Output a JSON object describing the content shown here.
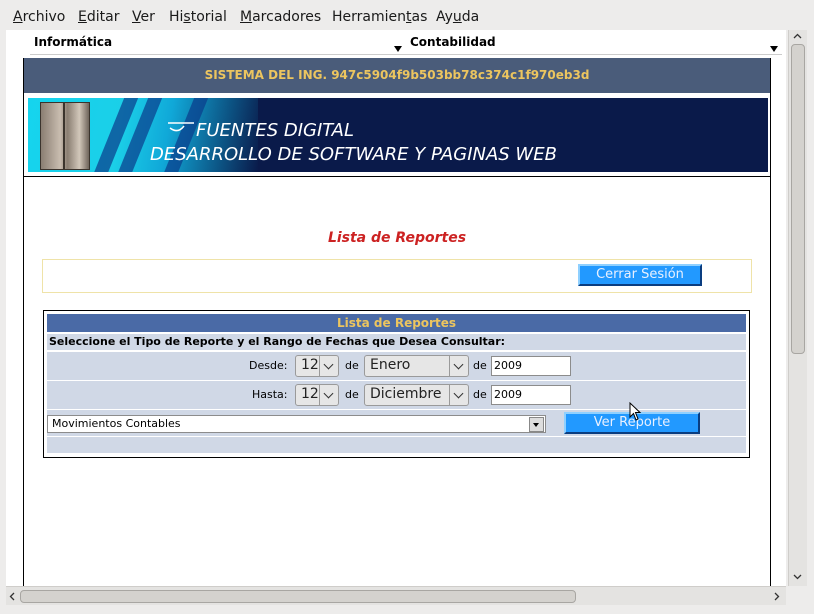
{
  "menu": [
    {
      "pre": "",
      "u": "A",
      "post": "rchivo"
    },
    {
      "pre": "",
      "u": "E",
      "post": "ditar"
    },
    {
      "pre": "",
      "u": "V",
      "post": "er"
    },
    {
      "pre": "Hi",
      "u": "s",
      "post": "torial"
    },
    {
      "pre": "",
      "u": "M",
      "post": "arcadores"
    },
    {
      "pre": "Herramien",
      "u": "t",
      "post": "as"
    },
    {
      "pre": "Ay",
      "u": "u",
      "post": "da"
    }
  ],
  "frames": {
    "left": "Informática",
    "right": "Contabilidad"
  },
  "header": {
    "system_title": "SISTEMA DEL ING. 947c5904f9b503bb78c374c1f970eb3d"
  },
  "banner": {
    "line1": "FUENTES DIGITAL",
    "line2": "DESARROLLO DE SOFTWARE Y PAGINAS WEB"
  },
  "page": {
    "title": "Lista de Reportes",
    "logout_label": "Cerrar Sesión"
  },
  "report": {
    "box_title": "Lista de Reportes",
    "instructions": "Seleccione el Tipo de Reporte y el Rango de Fechas que Desea Consultar:",
    "from": {
      "label": "Desde:",
      "day": "12",
      "de1": "de",
      "month": "Enero",
      "de2": "de",
      "year": "2009"
    },
    "to": {
      "label": "Hasta:",
      "day": "12",
      "de1": "de",
      "month": "Diciembre",
      "de2": "de",
      "year": "2009"
    },
    "report_type": "Movimientos Contables",
    "view_label": "Ver Reporte"
  },
  "colors": {
    "header_bg": "#4a5c7a",
    "header_text": "#ecc55f",
    "title_red": "#cc2222",
    "button_blue": "#2299ff"
  }
}
